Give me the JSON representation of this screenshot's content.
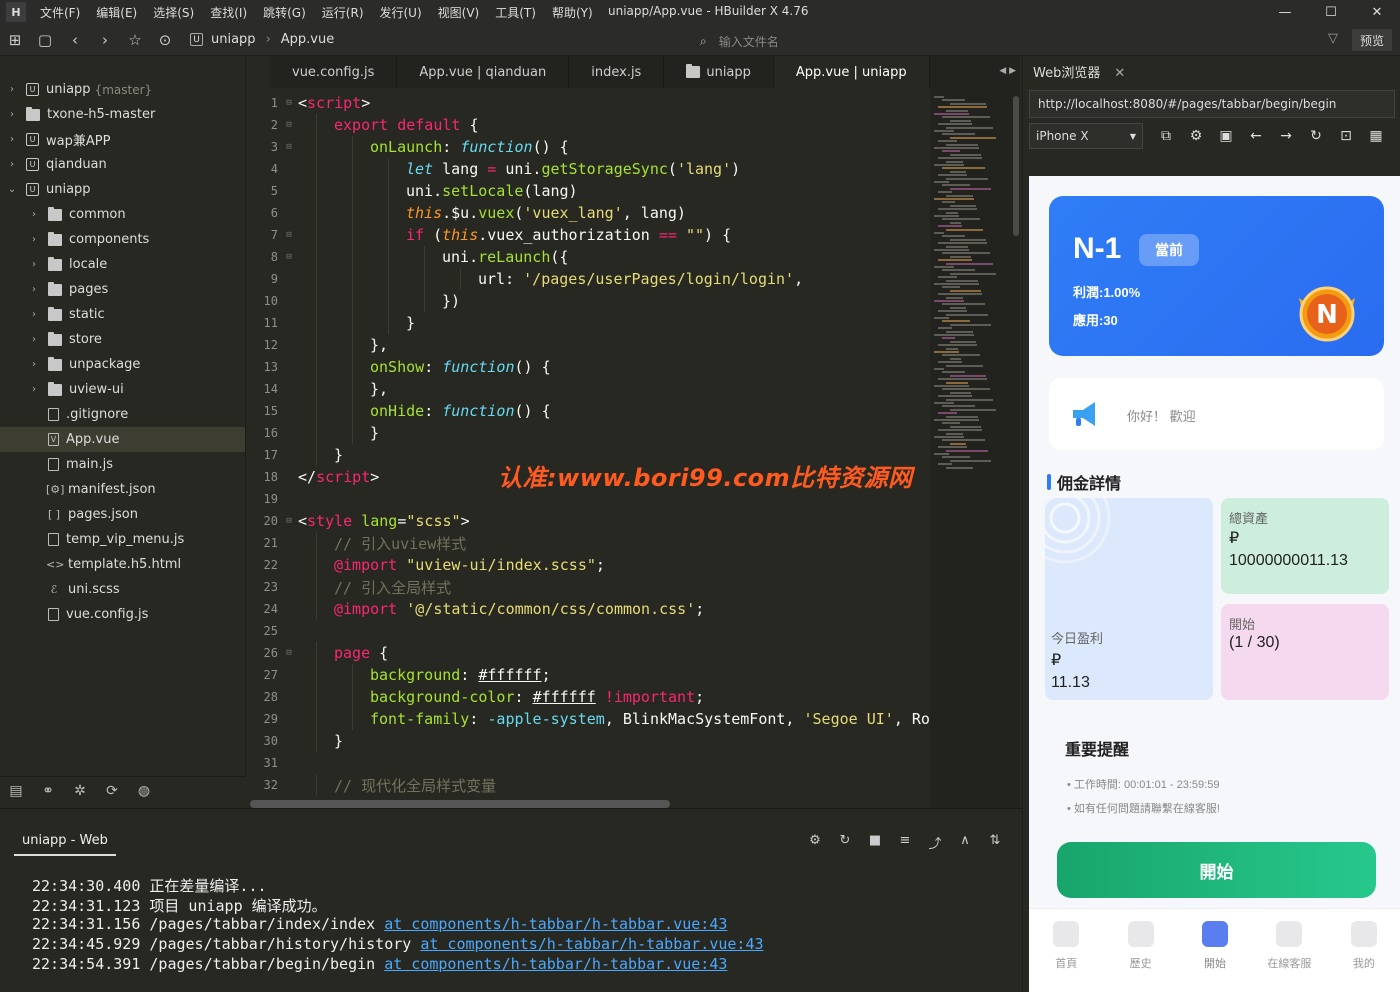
{
  "window": {
    "title": "uniapp/App.vue - HBuilder X 4.76",
    "minimize": "—",
    "maximize": "☐",
    "close": "✕"
  },
  "menu": [
    "文件(F)",
    "编辑(E)",
    "选择(S)",
    "查找(I)",
    "跳转(G)",
    "运行(R)",
    "发行(U)",
    "视图(V)",
    "工具(T)",
    "帮助(Y)"
  ],
  "toolbar": {
    "crumb_project": "uniapp",
    "crumb_file": "App.vue",
    "search_placeholder": "输入文件名",
    "preview_label": "预览"
  },
  "sidebar": {
    "items": [
      {
        "label": "uniapp",
        "git": "{master}",
        "kind": "project",
        "chev": "›",
        "indent": 0
      },
      {
        "label": "txone-h5-master",
        "kind": "folder",
        "chev": "›",
        "indent": 0
      },
      {
        "label": "wap兼APP",
        "kind": "project",
        "chev": "›",
        "indent": 0
      },
      {
        "label": "qianduan",
        "kind": "project",
        "chev": "›",
        "indent": 0
      },
      {
        "label": "uniapp",
        "kind": "project",
        "chev": "⌄",
        "indent": 0
      },
      {
        "label": "common",
        "kind": "folder",
        "chev": "›",
        "indent": 1
      },
      {
        "label": "components",
        "kind": "folder",
        "chev": "›",
        "indent": 1
      },
      {
        "label": "locale",
        "kind": "folder",
        "chev": "›",
        "indent": 1
      },
      {
        "label": "pages",
        "kind": "folder",
        "chev": "›",
        "indent": 1
      },
      {
        "label": "static",
        "kind": "folder",
        "chev": "›",
        "indent": 1
      },
      {
        "label": "store",
        "kind": "folder",
        "chev": "›",
        "indent": 1
      },
      {
        "label": "unpackage",
        "kind": "folder",
        "chev": "›",
        "indent": 1
      },
      {
        "label": "uview-ui",
        "kind": "folder",
        "chev": "›",
        "indent": 1
      },
      {
        "label": ".gitignore",
        "kind": "file",
        "chev": "",
        "indent": 1
      },
      {
        "label": "App.vue",
        "kind": "vue",
        "chev": "",
        "indent": 1,
        "active": true
      },
      {
        "label": "main.js",
        "kind": "js",
        "chev": "",
        "indent": 1
      },
      {
        "label": "manifest.json",
        "kind": "manifest",
        "chev": "",
        "indent": 1
      },
      {
        "label": "pages.json",
        "kind": "json",
        "chev": "",
        "indent": 1
      },
      {
        "label": "temp_vip_menu.js",
        "kind": "js",
        "chev": "",
        "indent": 1
      },
      {
        "label": "template.h5.html",
        "kind": "html",
        "chev": "",
        "indent": 1
      },
      {
        "label": "uni.scss",
        "kind": "scss",
        "chev": "",
        "indent": 1
      },
      {
        "label": "vue.config.js",
        "kind": "js",
        "chev": "",
        "indent": 1
      }
    ]
  },
  "tabs": [
    {
      "label": "vue.config.js"
    },
    {
      "label": "App.vue | qianduan"
    },
    {
      "label": "index.js"
    },
    {
      "label": "uniapp",
      "folder": true
    },
    {
      "label": "App.vue | uniapp",
      "active": true
    }
  ],
  "editor": {
    "watermark": "认准:www.bori99.com比特资源网",
    "lines": [
      {
        "n": "1",
        "fold": "⊟",
        "ind": 0,
        "tokens": [
          [
            "p",
            "<"
          ],
          [
            "k",
            "script"
          ],
          [
            "p",
            ">"
          ]
        ]
      },
      {
        "n": "2",
        "fold": "⊟",
        "ind": 1,
        "tokens": [
          [
            "k",
            "export default"
          ],
          [
            "p",
            " {"
          ]
        ]
      },
      {
        "n": "3",
        "fold": "⊟",
        "ind": 2,
        "tokens": [
          [
            "f",
            "onLaunch"
          ],
          [
            "p",
            ": "
          ],
          [
            "i",
            "function"
          ],
          [
            "p",
            "() {"
          ]
        ]
      },
      {
        "n": "4",
        "fold": "",
        "ind": 3,
        "tokens": [
          [
            "i",
            "let"
          ],
          [
            "p",
            " lang "
          ],
          [
            "k",
            "="
          ],
          [
            "p",
            " uni."
          ],
          [
            "f",
            "getStorageSync"
          ],
          [
            "p",
            "("
          ],
          [
            "s",
            "'lang'"
          ],
          [
            "p",
            ")"
          ]
        ]
      },
      {
        "n": "5",
        "fold": "",
        "ind": 3,
        "tokens": [
          [
            "p",
            "uni."
          ],
          [
            "f",
            "setLocale"
          ],
          [
            "p",
            "(lang)"
          ]
        ]
      },
      {
        "n": "6",
        "fold": "",
        "ind": 3,
        "tokens": [
          [
            "v",
            "this"
          ],
          [
            "p",
            ".$u."
          ],
          [
            "f",
            "vuex"
          ],
          [
            "p",
            "("
          ],
          [
            "s",
            "'vuex_lang'"
          ],
          [
            "p",
            ", lang)"
          ]
        ]
      },
      {
        "n": "7",
        "fold": "⊟",
        "ind": 3,
        "tokens": [
          [
            "k",
            "if"
          ],
          [
            "p",
            " ("
          ],
          [
            "v",
            "this"
          ],
          [
            "p",
            ".vuex_authorization "
          ],
          [
            "k",
            "=="
          ],
          [
            "p",
            " "
          ],
          [
            "s",
            "\"\""
          ],
          [
            "p",
            ") {"
          ]
        ]
      },
      {
        "n": "8",
        "fold": "⊟",
        "ind": 4,
        "tokens": [
          [
            "p",
            "uni."
          ],
          [
            "f",
            "reLaunch"
          ],
          [
            "p",
            "({"
          ]
        ]
      },
      {
        "n": "9",
        "fold": "",
        "ind": 5,
        "tokens": [
          [
            "p",
            "url: "
          ],
          [
            "s",
            "'/pages/userPages/login/login'"
          ],
          [
            "p",
            ","
          ]
        ]
      },
      {
        "n": "10",
        "fold": "",
        "ind": 4,
        "tokens": [
          [
            "p",
            "})"
          ]
        ]
      },
      {
        "n": "11",
        "fold": "",
        "ind": 3,
        "tokens": [
          [
            "p",
            "}"
          ]
        ]
      },
      {
        "n": "12",
        "fold": "",
        "ind": 2,
        "tokens": [
          [
            "p",
            "},"
          ]
        ]
      },
      {
        "n": "13",
        "fold": "",
        "ind": 2,
        "tokens": [
          [
            "f",
            "onShow"
          ],
          [
            "p",
            ": "
          ],
          [
            "i",
            "function"
          ],
          [
            "p",
            "() {"
          ]
        ]
      },
      {
        "n": "14",
        "fold": "",
        "ind": 2,
        "tokens": [
          [
            "p",
            "},"
          ]
        ]
      },
      {
        "n": "15",
        "fold": "",
        "ind": 2,
        "tokens": [
          [
            "f",
            "onHide"
          ],
          [
            "p",
            ": "
          ],
          [
            "i",
            "function"
          ],
          [
            "p",
            "() {"
          ]
        ]
      },
      {
        "n": "16",
        "fold": "",
        "ind": 2,
        "tokens": [
          [
            "p",
            "}"
          ]
        ]
      },
      {
        "n": "17",
        "fold": "",
        "ind": 1,
        "tokens": [
          [
            "p",
            "}"
          ]
        ]
      },
      {
        "n": "18",
        "fold": "",
        "ind": 0,
        "tokens": [
          [
            "p",
            "</"
          ],
          [
            "k",
            "script"
          ],
          [
            "p",
            ">"
          ]
        ]
      },
      {
        "n": "19",
        "fold": "",
        "ind": 0,
        "tokens": []
      },
      {
        "n": "20",
        "fold": "⊟",
        "ind": 0,
        "tokens": [
          [
            "p",
            "<"
          ],
          [
            "k",
            "style"
          ],
          [
            "p",
            " "
          ],
          [
            "f",
            "lang"
          ],
          [
            "p",
            "="
          ],
          [
            "s",
            "\"scss\""
          ],
          [
            "p",
            ">"
          ]
        ]
      },
      {
        "n": "21",
        "fold": "",
        "ind": 1,
        "tokens": [
          [
            "c",
            "// 引入uview样式"
          ]
        ]
      },
      {
        "n": "22",
        "fold": "",
        "ind": 1,
        "tokens": [
          [
            "k",
            "@import"
          ],
          [
            "p",
            " "
          ],
          [
            "s",
            "\"uview-ui/index.scss\""
          ],
          [
            "p",
            ";"
          ]
        ]
      },
      {
        "n": "23",
        "fold": "",
        "ind": 1,
        "tokens": [
          [
            "c",
            "// 引入全局样式"
          ]
        ]
      },
      {
        "n": "24",
        "fold": "",
        "ind": 1,
        "tokens": [
          [
            "k",
            "@import"
          ],
          [
            "p",
            " "
          ],
          [
            "s",
            "'@/static/common/css/common.css'"
          ],
          [
            "p",
            ";"
          ]
        ]
      },
      {
        "n": "25",
        "fold": "",
        "ind": 0,
        "tokens": []
      },
      {
        "n": "26",
        "fold": "⊟",
        "ind": 1,
        "tokens": [
          [
            "k",
            "page"
          ],
          [
            "p",
            " {"
          ]
        ]
      },
      {
        "n": "27",
        "fold": "",
        "ind": 2,
        "tokens": [
          [
            "f",
            "background"
          ],
          [
            "p",
            ": "
          ],
          [
            "u",
            "#ffffff"
          ],
          [
            "p",
            ";"
          ]
        ]
      },
      {
        "n": "28",
        "fold": "",
        "ind": 2,
        "tokens": [
          [
            "f",
            "background-color"
          ],
          [
            "p",
            ": "
          ],
          [
            "u",
            "#ffffff"
          ],
          [
            "p",
            " "
          ],
          [
            "k",
            "!important"
          ],
          [
            "p",
            ";"
          ]
        ]
      },
      {
        "n": "29",
        "fold": "",
        "ind": 2,
        "tokens": [
          [
            "f",
            "font-family"
          ],
          [
            "p",
            ": "
          ],
          [
            "t",
            "-apple-system"
          ],
          [
            "p",
            ", BlinkMacSystemFont, "
          ],
          [
            "s",
            "'Segoe UI'"
          ],
          [
            "p",
            ", Ro"
          ]
        ]
      },
      {
        "n": "30",
        "fold": "",
        "ind": 1,
        "tokens": [
          [
            "p",
            "}"
          ]
        ]
      },
      {
        "n": "31",
        "fold": "",
        "ind": 0,
        "tokens": []
      },
      {
        "n": "32",
        "fold": "",
        "ind": 1,
        "tokens": [
          [
            "c",
            "// 现代化全局样式变量"
          ]
        ]
      }
    ]
  },
  "console": {
    "tab": "uniapp - Web",
    "logs": [
      {
        "time": "22:34:30.400",
        "text": "正在差量编译...",
        "link": ""
      },
      {
        "time": "22:34:31.123",
        "text": "项目 uniapp 编译成功。",
        "link": ""
      },
      {
        "time": "22:34:31.156",
        "text": "/pages/tabbar/index/index ",
        "link": "at components/h-tabbar/h-tabbar.vue:43"
      },
      {
        "time": "22:34:45.929",
        "text": "/pages/tabbar/history/history ",
        "link": "at components/h-tabbar/h-tabbar.vue:43"
      },
      {
        "time": "22:34:54.391",
        "text": "/pages/tabbar/begin/begin ",
        "link": "at components/h-tabbar/h-tabbar.vue:43"
      }
    ]
  },
  "browser": {
    "tab": "Web浏览器",
    "url": "http://localhost:8080/#/pages/tabbar/begin/begin",
    "device": "iPhone X"
  },
  "app": {
    "level": "N-1",
    "current": "當前",
    "profit": "利潤:1.00%",
    "usage": "應用:30",
    "badge_letter": "N",
    "notice": "你好！ 歡迎",
    "section": "佣金詳情",
    "assets_label": "總資產",
    "assets_currency": "₽",
    "assets_value": "10000000011.13",
    "start_label": "開始",
    "start_value": "(1 / 30)",
    "today_label": "今日盈利",
    "today_currency": "₽",
    "today_value": "11.13",
    "reminder_title": "重要提醒",
    "reminder_1": "• 工作時間: 00:01:01 - 23:59:59",
    "reminder_2": "• 如有任何問題請聯繫在線客服!",
    "start_button": "開始",
    "nav": [
      {
        "label": "首頁"
      },
      {
        "label": "歷史"
      },
      {
        "label": "開始",
        "active": true
      },
      {
        "label": "在線客服"
      },
      {
        "label": "我的"
      }
    ]
  },
  "colors": {
    "accent": "#2f7df6",
    "green": "#18a56c",
    "editor_bg": "#272822"
  }
}
